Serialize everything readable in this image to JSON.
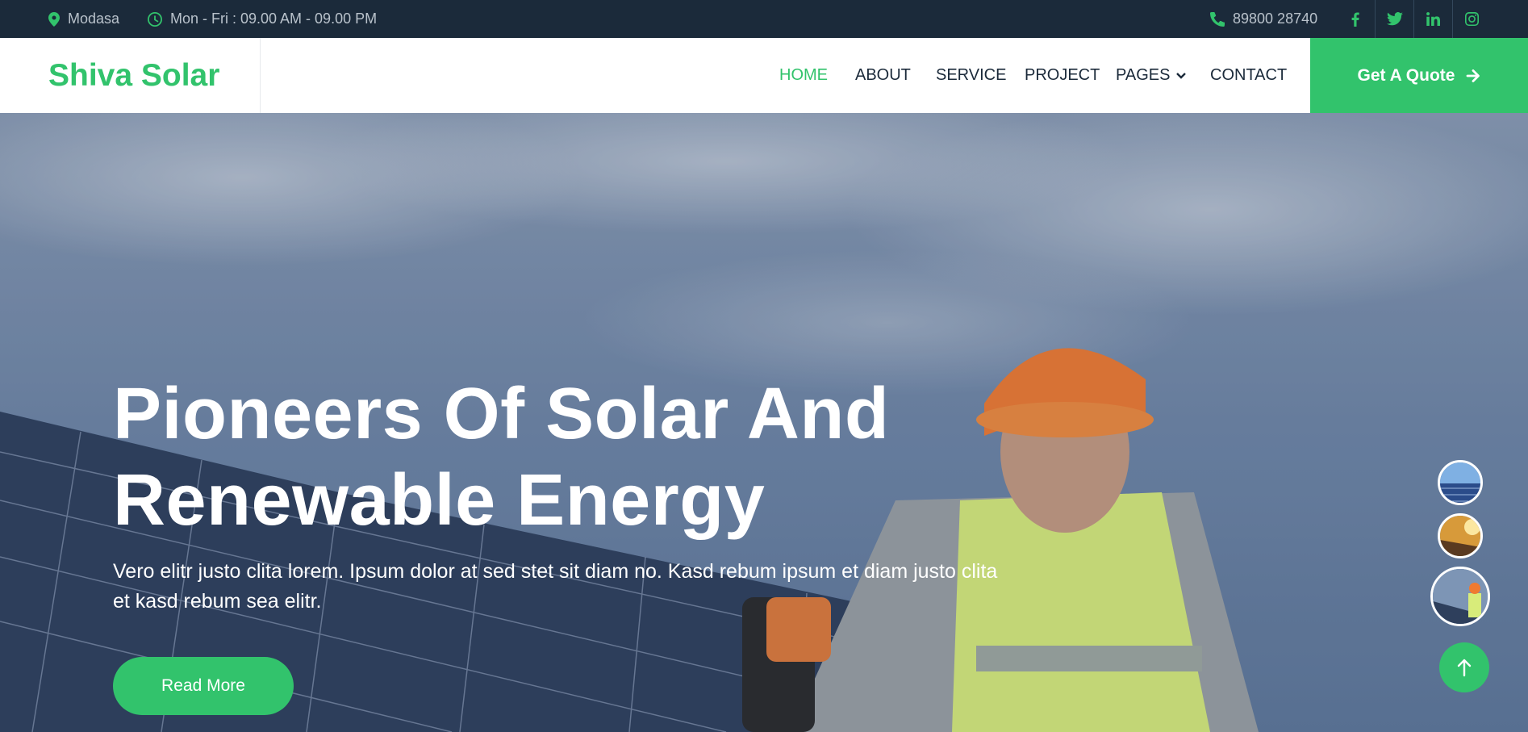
{
  "topbar": {
    "location": "Modasa",
    "hours": "Mon - Fri : 09.00 AM - 09.00 PM",
    "phone": "89800 28740",
    "social": [
      "facebook-icon",
      "twitter-icon",
      "linkedin-icon",
      "instagram-icon"
    ]
  },
  "brand": {
    "name": "Shiva Solar"
  },
  "nav": {
    "items": [
      {
        "label": "HOME",
        "active": true
      },
      {
        "label": "ABOUT"
      },
      {
        "label": "SERVICE"
      },
      {
        "label": "PROJECT"
      },
      {
        "label": "PAGES",
        "dropdown": true
      },
      {
        "label": "CONTACT"
      }
    ],
    "cta": "Get A Quote"
  },
  "hero": {
    "title_line1": "Pioneers Of Solar And",
    "title_line2": "Renewable Energy",
    "text": "Vero elitr justo clita lorem. Ipsum dolor at sed stet sit diam no. Kasd rebum ipsum et diam justo clita et kasd rebum sea elitr.",
    "button": "Read More"
  },
  "colors": {
    "accent": "#32c36c",
    "dark": "#1b2a3a",
    "text": "#ffffff"
  }
}
